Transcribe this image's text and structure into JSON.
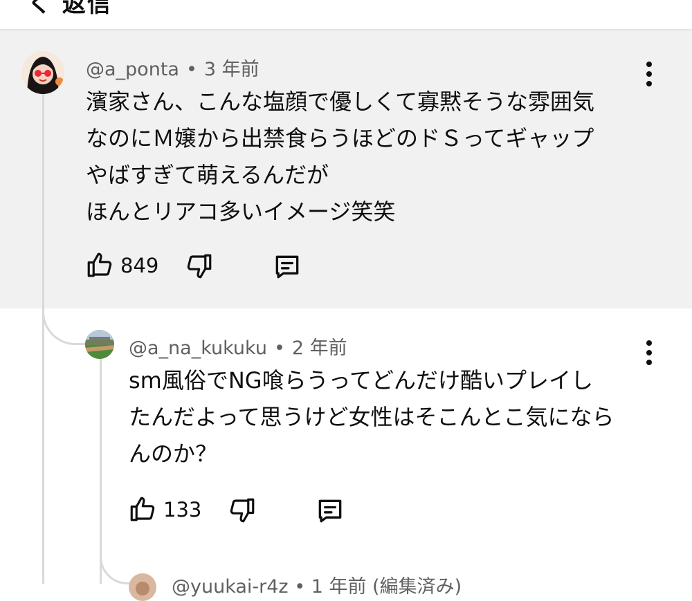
{
  "header": {
    "title": "く 返信"
  },
  "comments": [
    {
      "username": "@a_ponta",
      "separator": "•",
      "time": "3 年前",
      "lines": [
        "濱家さん、こんな塩顔で優しくて寡黙そうな雰囲気",
        "なのにＭ嬢から出禁食らうほどのドＳってギャップ",
        "やばすぎて萌えるんだが",
        "ほんとリアコ多いイメージ笑笑"
      ],
      "likes": "849"
    },
    {
      "username": "@a_na_kukuku",
      "separator": "•",
      "time": "2 年前",
      "lines": [
        "sm風俗でNG喰らうってどんだけ酷いプレイし",
        "たんだよって思うけど女性はそこんとこ気になら",
        "んのか？"
      ],
      "likes": "133"
    }
  ],
  "partial": {
    "meta": "@yuukai-r4z • 1 年前 (編集済み)"
  },
  "colors": {
    "highlight_bg": "#f1f1f1",
    "meta_text": "#606060",
    "thread_line": "#d9d9d9"
  },
  "icons": [
    "thumbs-up-icon",
    "thumbs-down-icon",
    "reply-comment-icon",
    "more-vert-icon"
  ]
}
